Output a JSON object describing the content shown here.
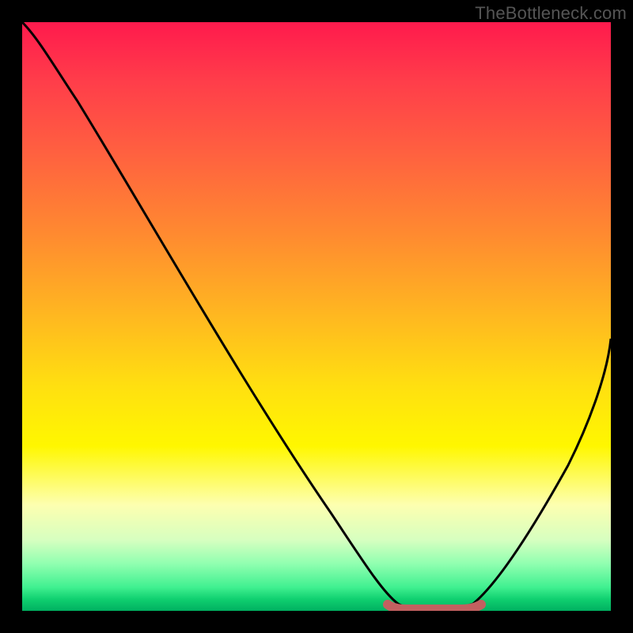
{
  "watermark": "TheBottleneck.com",
  "chart_data": {
    "type": "line",
    "title": "",
    "xlabel": "",
    "ylabel": "",
    "xlim": [
      0,
      100
    ],
    "ylim": [
      0,
      100
    ],
    "grid": false,
    "legend": false,
    "series": [
      {
        "name": "bottleneck-curve",
        "x": [
          0,
          4,
          10,
          20,
          30,
          40,
          50,
          57,
          62,
          66,
          70,
          74,
          78,
          84,
          90,
          96,
          100
        ],
        "y": [
          100,
          98,
          90,
          74,
          58,
          42,
          26,
          12,
          4,
          0,
          0,
          0,
          4,
          14,
          26,
          40,
          50
        ]
      },
      {
        "name": "optimal-band",
        "x": [
          62,
          78
        ],
        "y": [
          0,
          0
        ]
      }
    ],
    "colors": {
      "curve": "#000000",
      "band": "#c26060",
      "gradient_top": "#ff1a4d",
      "gradient_mid": "#ffe010",
      "gradient_bottom": "#00b060"
    }
  }
}
